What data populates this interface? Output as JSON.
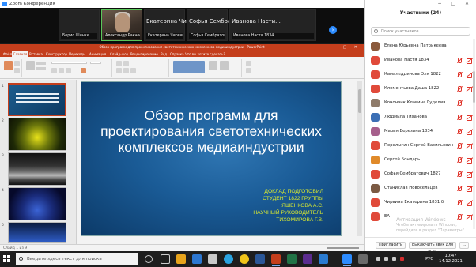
{
  "zoom": {
    "title": "Zoom Конференция",
    "gallery": [
      {
        "name": "Борис Шинке",
        "big": ""
      },
      {
        "name": "Александр Ракчеев",
        "big": "",
        "camera": true
      },
      {
        "name": "Екатерина Чирвина",
        "big": "Екатерина Чир..."
      },
      {
        "name": "Софья Сембратович",
        "big": "Софья Сембрат..."
      },
      {
        "name": "Иванова Настя 1834",
        "big": "Иванова Насти..."
      }
    ],
    "gallery_next": "›"
  },
  "ppt": {
    "title": "Обзор программ для проектирования светотехнических комплексов медиаиндустрии - PowerPoint",
    "tabs": [
      "Файл",
      "Главная",
      "Вставка",
      "Конструктор",
      "Переходы",
      "Анимация",
      "Слайд-шоу",
      "Рецензирование",
      "Вид",
      "Справка",
      "Что вы хотите сделать?"
    ],
    "thumb_numbers": [
      "1",
      "2",
      "3",
      "4",
      "5"
    ],
    "slide": {
      "title": "Обзор программ для проектирования светотехнических комплексов медиаиндустрии",
      "subtitle": [
        "ДОКЛАД ПОДГОТОВИЛ",
        "СТУДЕНТ 1822 ГРУППЫ",
        "ЯШЕНКОВА А.С.",
        "НАУЧНЫЙ РУКОВОДИТЕЛЬ",
        "ТИХОМИРОВА Г.В."
      ]
    },
    "status": "Слайд 1 из 9"
  },
  "participants": {
    "title": "Участники (24)",
    "search_placeholder": "Поиск участников",
    "items": [
      {
        "name": "Елена Юрьевна Патрикеева",
        "color": "#8b5a3c"
      },
      {
        "name": "Иванова Настя 1834",
        "color": "#e04a3a"
      },
      {
        "name": "Камаледдинова Эля 1822",
        "color": "#e04a3a"
      },
      {
        "name": "Клементьева Даша 1822",
        "color": "#e04a3a"
      },
      {
        "name": "Конончик Клавина Гуделия",
        "color": "#8f7b6a"
      },
      {
        "name": "Людмила Тиханова",
        "color": "#3c6fb5"
      },
      {
        "name": "Мария Березина 1834",
        "color": "#a65f8c"
      },
      {
        "name": "Перелыгин Сергей Васильевич",
        "color": "#e04a3a"
      },
      {
        "name": "Сергей Бондарь",
        "color": "#e08a2a"
      },
      {
        "name": "Софья Сембратович 1827",
        "color": "#e04a3a"
      },
      {
        "name": "Станислав Новосельцев",
        "color": "#7b5a43"
      },
      {
        "name": "Чирвина Екатерина 1831 б",
        "color": "#e04a3a"
      },
      {
        "name": "ЕА",
        "color": "#e04a3a"
      }
    ],
    "watermark_title": "Активация Windows",
    "watermark_text": "Чтобы активировать Windows, перейдите в раздел \"Параметры\".",
    "invite_label": "Пригласить",
    "mute_all_label": "Выключить звук для всех",
    "more_label": "..."
  },
  "taskbar": {
    "search_placeholder": "Введите здесь текст для поиска",
    "lang": "РУС",
    "time": "10:47",
    "date": "14.12.2021"
  }
}
